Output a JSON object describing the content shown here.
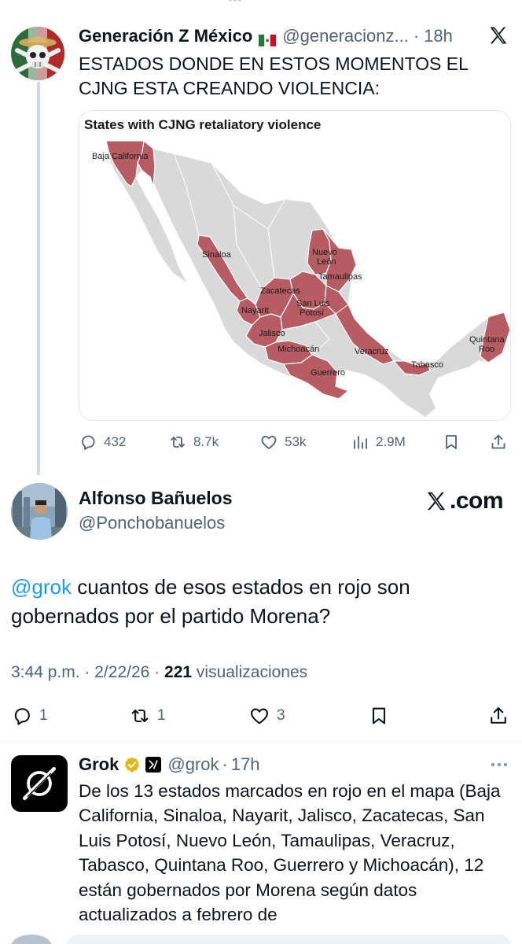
{
  "tweet1": {
    "author_name": "Generación Z México",
    "handle": "@generacionz...",
    "separator": "·",
    "time": "18h",
    "text": "ESTADOS DONDE EN ESTOS MOMENTOS EL CJNG ESTA CREANDO VIOLENCIA:",
    "map": {
      "title": "States with CJNG retaliatory violence",
      "highlight_color": "#b85c63",
      "base_color": "#d9d9d9",
      "labels": {
        "baja_california": "Baja California",
        "sinaloa": "Sinaloa",
        "nuevo_leon_1": "Nuevo",
        "nuevo_leon_2": "León",
        "tamaulipas": "Tamaulipas",
        "zacatecas": "Zacatecas",
        "slp_1": "San Luis",
        "slp_2": "Potosí",
        "nayarit": "Nayarit",
        "jalisco": "Jalisco",
        "michoacan": "Michoacán",
        "veracruz": "Veracruz",
        "guerrero": "Guerrero",
        "tabasco": "Tabasco",
        "qroo_1": "Quintana",
        "qroo_2": "Roo"
      }
    },
    "stats": {
      "replies": "432",
      "reposts": "8.7k",
      "likes": "53k",
      "views": "2.9M"
    }
  },
  "tweet2": {
    "author_name": "Alfonso Bañuelos",
    "handle": "@Ponchobanuelos",
    "brand": ".com",
    "mention": "@grok",
    "text": " cuantos de esos estados en rojo son gobernados por el partido Morena?",
    "time": "3:44 p.m.",
    "date": "2/22/26",
    "sep": "·",
    "views_count": "221",
    "views_label": "visualizaciones",
    "stats": {
      "replies": "1",
      "reposts": "1",
      "likes": "3"
    }
  },
  "tweet3": {
    "author_name": "Grok",
    "handle": "@grok",
    "separator": "·",
    "time": "17h",
    "text": "De los 13 estados marcados en rojo en el mapa (Baja California, Sinaloa, Nayarit, Jalisco, Zacatecas, San Luis Potosí, Nuevo León, Tamaulipas, Veracruz, Tabasco, Quintana Roo, Guerrero y Michoacán), 12 están gobernados por Morena según datos actualizados a febrero de"
  },
  "colors": {
    "accent": "#1d9bf0",
    "secondary_text": "#536471",
    "verified_gold": "#e2b719"
  }
}
